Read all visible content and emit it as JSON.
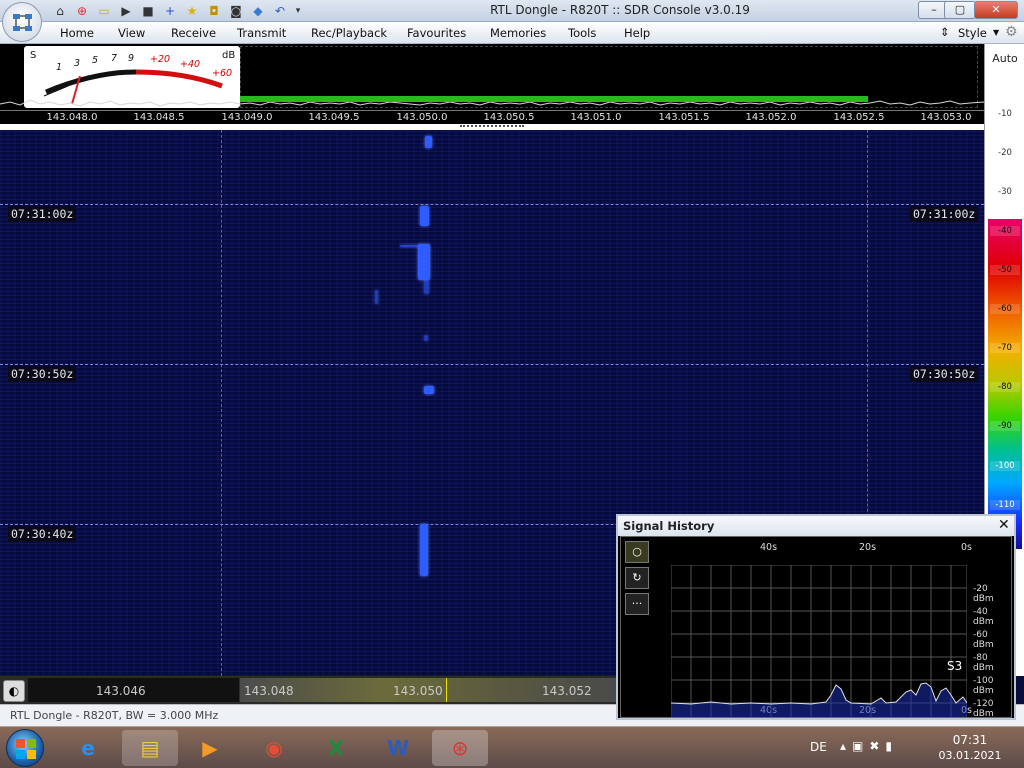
{
  "window": {
    "title": "RTL Dongle - R820T :: SDR Console v3.0.19",
    "minimize": "–",
    "maximize": "▢",
    "close": "✕"
  },
  "qat_icons": [
    "home-icon",
    "help-lifebuoy-icon",
    "folder-icon",
    "play-icon",
    "stop-icon",
    "plus-icon",
    "star-icon",
    "lock-icon",
    "camera-icon",
    "drop-icon",
    "undo-icon",
    "dropdown-icon"
  ],
  "menu": {
    "items": [
      "Home",
      "View",
      "Receive",
      "Transmit",
      "Rec/Playback",
      "Favourites",
      "Memories",
      "Tools",
      "Help"
    ],
    "style_label": "Style"
  },
  "smeter": {
    "s_label": "S",
    "db_label": "dB",
    "scale": [
      "1",
      "3",
      "5",
      "7",
      "9",
      "+20",
      "+40",
      "+60"
    ]
  },
  "frequency_scale": [
    "143.048.0",
    "143.048.5",
    "143.049.0",
    "143.049.5",
    "143.050.0",
    "143.050.5",
    "143.051.0",
    "143.051.5",
    "143.052.0",
    "143.052.5",
    "143.053.0"
  ],
  "right_scale": {
    "auto_label": "Auto",
    "db_values": [
      "-10",
      "-20",
      "-30",
      "-40",
      "-50",
      "-60",
      "-70",
      "-80",
      "-90",
      "-100",
      "-110"
    ]
  },
  "waterfall": {
    "time_labels": [
      "07:31:00z",
      "07:30:50z",
      "07:30:40z"
    ]
  },
  "bottom_scale": [
    "143.046",
    "143.048",
    "143.050",
    "143.052"
  ],
  "status": {
    "text": "RTL Dongle - R820T, BW = 3.000 MHz"
  },
  "signal_history": {
    "title": "Signal History",
    "close": "✕",
    "buttons": [
      "○",
      "↻",
      "···"
    ],
    "time_labels": [
      "40s",
      "20s",
      "0s"
    ],
    "y_labels": [
      "-20 dBm",
      "-40 dBm",
      "-60 dBm",
      "-80 dBm",
      "-100 dBm",
      "-120 dBm"
    ],
    "s_reading": "S3"
  },
  "taskbar": {
    "apps": [
      "internet-explorer-icon",
      "file-explorer-icon",
      "media-player-icon",
      "chrome-icon",
      "excel-icon",
      "word-icon",
      "sdr-console-icon"
    ],
    "lang": "DE",
    "time": "07:31",
    "date": "03.01.2021"
  },
  "colors": {
    "accent": "#2f5cff",
    "background": "#050a40",
    "smeter_red": "#e01010",
    "spectrum_green": "#22bb22"
  }
}
